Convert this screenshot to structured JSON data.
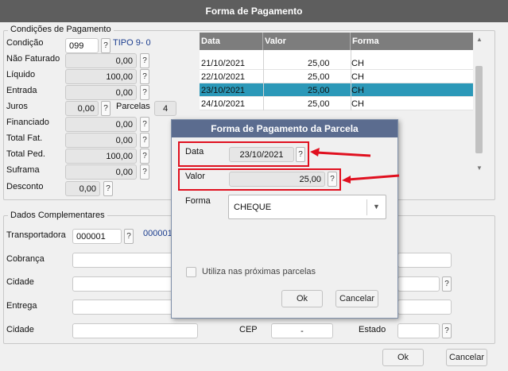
{
  "window": {
    "title": "Forma de Pagamento"
  },
  "pagamento": {
    "group_label": "Condições de Pagamento",
    "condicao_label": "Condição",
    "condicao_value": "099",
    "condicao_desc": "TIPO 9- 0",
    "nao_faturado_label": "Não Faturado",
    "nao_faturado_value": "0,00",
    "liquido_label": "Líquido",
    "liquido_value": "100,00",
    "entrada_label": "Entrada",
    "entrada_value": "0,00",
    "juros_label": "Juros",
    "juros_value": "0,00",
    "parcelas_label": "Parcelas",
    "parcelas_value": "4",
    "financiado_label": "Financiado",
    "financiado_value": "0,00",
    "total_fat_label": "Total Fat.",
    "total_fat_value": "0,00",
    "total_ped_label": "Total Ped.",
    "total_ped_value": "100,00",
    "suframa_label": "Suframa",
    "suframa_value": "0,00",
    "desconto_label": "Desconto",
    "desconto_value": "0,00",
    "help": "?"
  },
  "parcelas_grid": {
    "headers": {
      "data": "Data",
      "valor": "Valor",
      "forma": "Forma"
    },
    "rows": [
      {
        "data": "21/10/2021",
        "valor": "25,00",
        "forma": "CH"
      },
      {
        "data": "22/10/2021",
        "valor": "25,00",
        "forma": "CH"
      },
      {
        "data": "23/10/2021",
        "valor": "25,00",
        "forma": "CH"
      },
      {
        "data": "24/10/2021",
        "valor": "25,00",
        "forma": "CH"
      }
    ],
    "selected_index": 2
  },
  "complementares": {
    "group_label": "Dados Complementares",
    "transportadora_label": "Transportadora",
    "transportadora_value": "000001",
    "transportadora_desc": "000001",
    "cobranca_label": "Cobrança",
    "cidade_label": "Cidade",
    "entrega_label": "Entrega",
    "cidade2_label": "Cidade",
    "cep_label": "CEP",
    "cep_value": "-",
    "estado_label": "Estado"
  },
  "footer": {
    "ok": "Ok",
    "cancelar": "Cancelar"
  },
  "modal": {
    "title": "Forma de Pagamento da Parcela",
    "data_label": "Data",
    "data_value": "23/10/2021",
    "valor_label": "Valor",
    "valor_value": "25,00",
    "forma_label": "Forma",
    "forma_value": "CHEQUE",
    "checkbox_label": "Utiliza nas próximas parcelas",
    "checkbox_checked": false,
    "ok": "Ok",
    "cancelar": "Cancelar"
  },
  "colors": {
    "highlight": "#e0101f",
    "selected_row": "#2b98b8"
  }
}
